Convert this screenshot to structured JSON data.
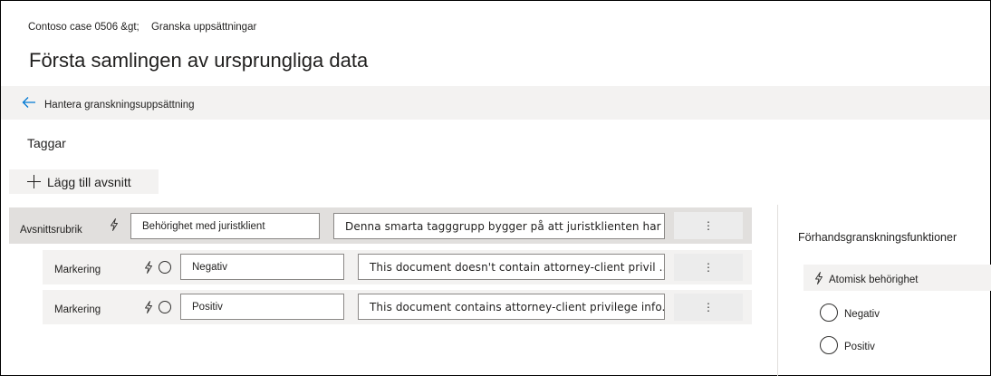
{
  "breadcrumb": {
    "case": "Contoso case 0506 &gt;",
    "page": "Granska uppsättningar"
  },
  "page_title": "Första samlingen av ursprungliga data",
  "manage_bar": {
    "label": "Hantera granskningsuppsättning",
    "back_icon": "arrow-left-icon"
  },
  "tags_heading": "Taggar",
  "add_section": {
    "label": "Lägg till avsnitt",
    "icon": "plus-icon"
  },
  "rows": {
    "header": {
      "type_label": "Avsnittsrubrik",
      "name": "Behörighet med juristklient",
      "description": "Denna smarta tagggrupp bygger på att juristklienten har företräde ...",
      "more": "⋮"
    },
    "child1": {
      "type_label": "Markering",
      "name": "Negativ",
      "description": "This document doesn't contain attorney-client privil ...",
      "more": "⋮"
    },
    "child2": {
      "type_label": "Markering",
      "name": "Positiv",
      "description": "This document contains attorney-client privilege info.",
      "more": "⋮"
    }
  },
  "preview": {
    "title": "Förhandsgranskningsfunktioner",
    "group_label": "Atomisk behörighet",
    "options": [
      "Negativ",
      "Positiv"
    ]
  },
  "colors": {
    "accent": "#0078d4",
    "bar": "#f3f2f1",
    "header_row": "#e1dfdd"
  }
}
